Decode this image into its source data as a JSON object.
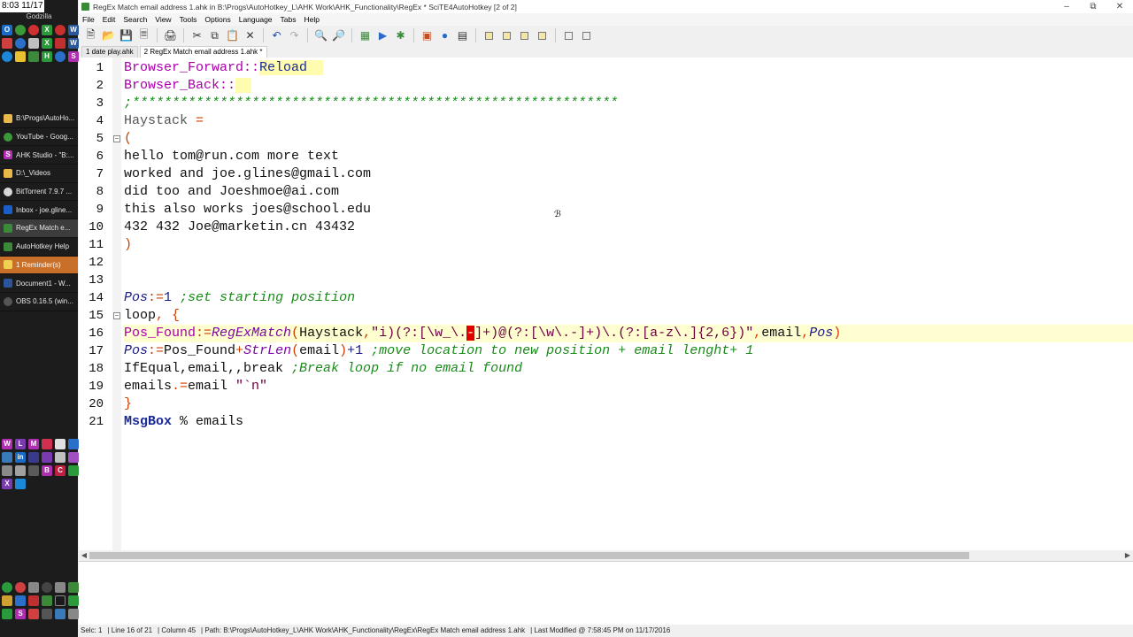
{
  "taskbar": {
    "clock": "8:03 11/17",
    "machine": "Godzilla",
    "tasks": [
      {
        "label": "B:\\Progs\\AutoHo...",
        "icon": "folder-icon",
        "color": "#e8b84a",
        "glyph": ""
      },
      {
        "label": "YouTube - Goog...",
        "icon": "chrome-icon",
        "color": "#3a9a3a",
        "glyph": ""
      },
      {
        "label": "AHK Studio - \"B:...",
        "icon": "ahk-studio-icon",
        "color": "#b02fb0",
        "glyph": "S"
      },
      {
        "label": "D:\\_Videos",
        "icon": "folder-icon",
        "color": "#e8b84a",
        "glyph": ""
      },
      {
        "label": "BitTorrent 7.9.7 ...",
        "icon": "bittorrent-icon",
        "color": "#d8d8d8",
        "glyph": ""
      },
      {
        "label": "Inbox - joe.gline...",
        "icon": "outlook-icon",
        "color": "#1a5ec8",
        "glyph": ""
      },
      {
        "label": "RegEx Match  e...",
        "icon": "scite-icon",
        "color": "#3a8a3a",
        "glyph": ""
      },
      {
        "label": "AutoHotkey Help",
        "icon": "ahk-help-icon",
        "color": "#3a8a3a",
        "glyph": ""
      },
      {
        "label": "1 Reminder(s)",
        "icon": "reminder-icon",
        "color": "#f0d050",
        "glyph": ""
      },
      {
        "label": "Document1 - W...",
        "icon": "word-icon",
        "color": "#2b579a",
        "glyph": ""
      },
      {
        "label": "OBS 0.16.5 (win...",
        "icon": "obs-icon",
        "color": "#444",
        "glyph": ""
      }
    ]
  },
  "window": {
    "title": "RegEx Match  email address  1.ahk in B:\\Progs\\AutoHotkey_L\\AHK Work\\AHK_Functionality\\RegEx * SciTE4AutoHotkey [2 of 2]",
    "menus": [
      "File",
      "Edit",
      "Search",
      "View",
      "Tools",
      "Options",
      "Language",
      "Tabs",
      "Help"
    ],
    "tabs": [
      "1 date play.ahk",
      "2 RegEx Match  email address  1.ahk *"
    ]
  },
  "code": {
    "line_numbers": [
      "1",
      "2",
      "3",
      "4",
      "5",
      "6",
      "7",
      "8",
      "9",
      "10",
      "11",
      "12",
      "13",
      "14",
      "15",
      "16",
      "17",
      "18",
      "19",
      "20",
      "21"
    ],
    "l1": {
      "label": "Browser_Forward",
      "sep": "::",
      "cmd": "Reload"
    },
    "l2": {
      "label": "Browser_Back",
      "sep": "::"
    },
    "l3": {
      "text": ";*************************************************************"
    },
    "l4": {
      "var": "Haystack",
      "op": " ="
    },
    "l5": {
      "text": "("
    },
    "l6": {
      "text": "hello tom@run.com more text"
    },
    "l7": {
      "text": "worked and joe.glines@gmail.com"
    },
    "l8": {
      "text": "did too and Joeshmoe@ai.com"
    },
    "l9": {
      "text": "this also works joes@school.edu"
    },
    "l10": {
      "text": "432 432 Joe@marketin.cn 43432"
    },
    "l11": {
      "text": ")"
    },
    "l14": {
      "var": "Pos",
      "op": ":=",
      "num": "1",
      "comment": " ;set starting position"
    },
    "l15": {
      "kw": "loop",
      "rest": ", {"
    },
    "l16": {
      "var": "Pos_Found",
      "op": ":=",
      "fn": "RegExMatch",
      "p1": "(",
      "arg1": "Haystack",
      "comma": ",",
      "str_a": "\"i)(?:[\\w_\\.",
      "caret": "-",
      "str_b": "]+)@(?:[\\w\\.-]+)\\.(?:[a-z\\.]{2,6})\"",
      "comma2": ",",
      "arg2": "email",
      "comma3": ",",
      "arg3": "Pos",
      "p2": ")"
    },
    "l17": {
      "var": "Pos",
      "op": ":=",
      "v2": "Pos_Found",
      "plus": "+",
      "fn": "StrLen",
      "p1": "(",
      "arg": "email",
      "p2": ")",
      "plus2": "+1",
      "comment": " ;move location to new position + email lenght+ 1"
    },
    "l18": {
      "cmd": "IfEqual",
      "rest": ",email,,break",
      "comment": " ;Break loop if no email found"
    },
    "l19": {
      "v": "emails",
      "op": ".=",
      "rest": "email ",
      "str": "\"`n\""
    },
    "l20": {
      "text": "}"
    },
    "l21": {
      "cmd": "MsgBox",
      "rest": " % emails"
    }
  },
  "status": {
    "sel": "Selc: 1",
    "line": "Line 16 of 21",
    "column": "Column 45",
    "path": "Path: B:\\Progs\\AutoHotkey_L\\AHK Work\\AHK_Functionality\\RegEx\\RegEx Match  email address  1.ahk",
    "modified": "Last Modified @ 7:58:45 PM on 11/17/2016"
  }
}
